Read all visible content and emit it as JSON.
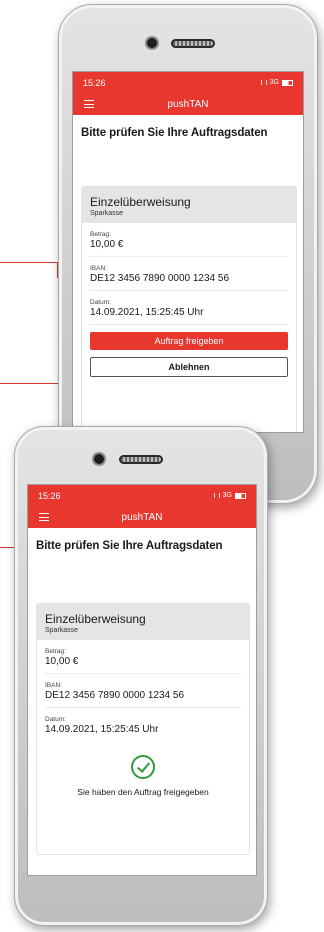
{
  "colors": {
    "accent": "#e8372e",
    "success": "#2e9a3c",
    "card_header": "#e3e5e6"
  },
  "top_screen": {
    "status": {
      "time": "15:26",
      "network": "3G"
    },
    "app_title": "pushTAN",
    "headline": "Bitte prüfen Sie Ihre Auftragsdaten",
    "card": {
      "title": "Einzelüberweisung",
      "subtitle": "Sparkasse",
      "fields": [
        {
          "label": "Betrag:",
          "value": "10,00 €"
        },
        {
          "label": "IBAN:",
          "value": "DE12 3456 7890 0000 1234 56"
        },
        {
          "label": "Datum:",
          "value": "14.09.2021, 15:25:45 Uhr"
        }
      ]
    },
    "approve_label": "Auftrag freigeben",
    "reject_label": "Ablehnen"
  },
  "bottom_screen": {
    "status": {
      "time": "15:26",
      "network": "3G"
    },
    "app_title": "pushTAN",
    "headline": "Bitte prüfen Sie Ihre Auftragsdaten",
    "card": {
      "title": "Einzelüberweisung",
      "subtitle": "Sparkasse",
      "fields": [
        {
          "label": "Betrag:",
          "value": "10,00 €"
        },
        {
          "label": "IBAN:",
          "value": "DE12 3456 7890 0000 1234 56"
        },
        {
          "label": "Datum:",
          "value": "14.09.2021, 15:25:45 Uhr"
        }
      ]
    },
    "confirm_icon": "check-circle-icon",
    "confirm_text": "Sie haben den Auftrag freigegeben"
  }
}
